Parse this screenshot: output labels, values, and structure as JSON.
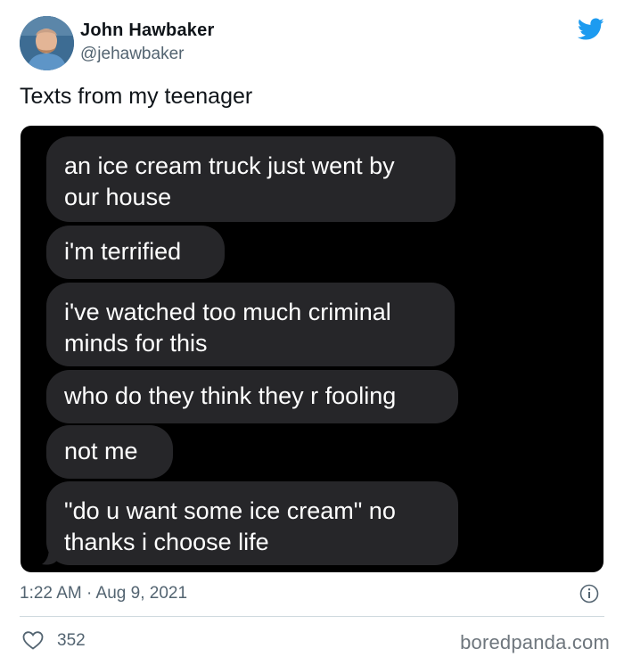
{
  "tweet": {
    "author": {
      "name": "John Hawbaker",
      "handle": "@jehawbaker",
      "avatar_icon": "user-avatar"
    },
    "brand_icon": "twitter-bird-icon",
    "brand_color": "#1d9bf0",
    "text": "Texts from my teenager",
    "media": {
      "background": "#000000",
      "bubble_color": "#262629",
      "messages": [
        "an ice cream truck just went by\nour house",
        "i'm terrified",
        "i've watched too much criminal\nminds for this",
        "who do they think they r fooling",
        "not me",
        "\"do u want some ice cream\" no\nthanks i choose life"
      ]
    },
    "timestamp": "1:22 AM · Aug 9, 2021",
    "info_icon": "info-icon",
    "likes": {
      "icon": "heart-icon",
      "count": "352"
    }
  },
  "watermark": "boredpanda.com"
}
